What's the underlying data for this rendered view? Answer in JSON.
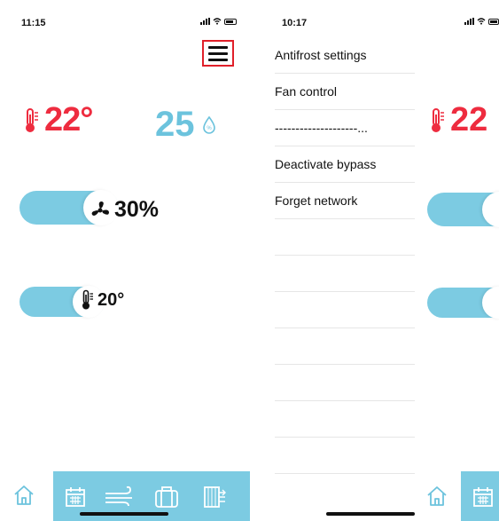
{
  "left_screen": {
    "status_time": "11:15",
    "indoor_temperature": "22°",
    "humidity": "25",
    "fan_speed": "30%",
    "fan_level": 0.3,
    "setpoint_temperature": "20°",
    "icons": {
      "menu": "hamburger-menu-icon",
      "thermometer": "thermometer-icon",
      "humidity": "humidity-drop-icon",
      "fan": "fan-icon"
    }
  },
  "right_screen": {
    "status_time": "10:17",
    "menu_items": [
      "Antifrost settings",
      "Fan control",
      "--------------------...",
      "Deactivate bypass",
      "Forget network"
    ],
    "peek_temperature": "22"
  },
  "tabbar": {
    "items": [
      "home-icon",
      "calendar-icon",
      "wind-icon",
      "luggage-icon",
      "filter-icon"
    ]
  },
  "colors": {
    "accent_red": "#ee2c3f",
    "accent_blue": "#7ccbe2",
    "humidity_blue": "#6cc3dd",
    "highlight_border": "#e0202a"
  }
}
